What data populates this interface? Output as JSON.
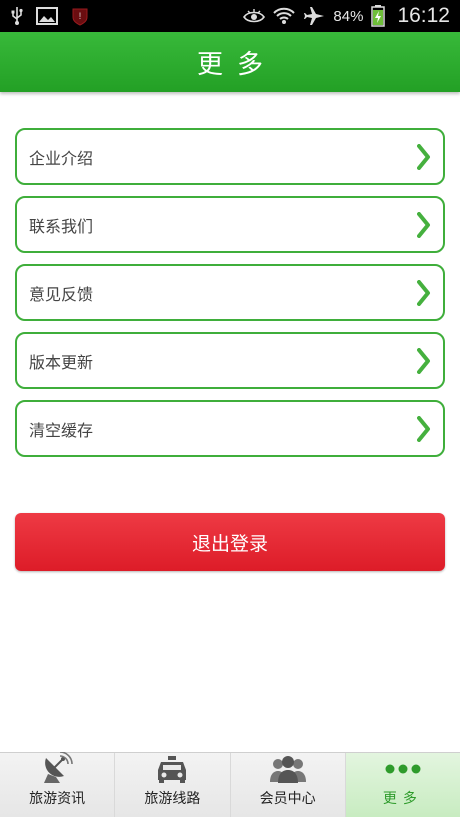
{
  "status_bar": {
    "battery_percent": "84%",
    "time": "16:12",
    "icons": [
      "usb-icon",
      "image-icon",
      "notification-badge-icon",
      "eye-icon",
      "wifi-icon",
      "airplane-icon",
      "battery-charging-icon"
    ]
  },
  "header": {
    "title": "更多"
  },
  "menu": {
    "items": [
      {
        "label": "企业介绍"
      },
      {
        "label": "联系我们"
      },
      {
        "label": "意见反馈"
      },
      {
        "label": "版本更新"
      },
      {
        "label": "清空缓存"
      }
    ]
  },
  "logout": {
    "label": "退出登录"
  },
  "tabbar": {
    "active_index": 3,
    "tabs": [
      {
        "label": "旅游资讯",
        "icon": "satellite-dish-icon"
      },
      {
        "label": "旅游线路",
        "icon": "car-icon"
      },
      {
        "label": "会员中心",
        "icon": "users-icon"
      },
      {
        "label": "更多",
        "icon": "more-dots-icon"
      }
    ]
  },
  "colors": {
    "primary_green": "#2eaa2e",
    "logout_red": "#e5262f",
    "border_green": "#3fae3b"
  }
}
